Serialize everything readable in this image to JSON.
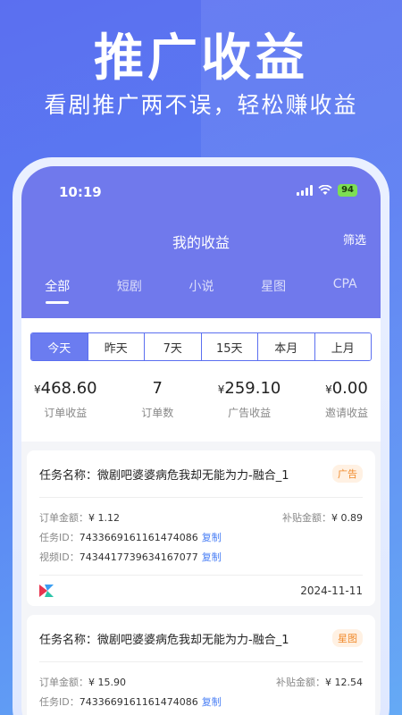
{
  "promo": {
    "title": "推广收益",
    "subtitle": "看剧推广两不误，轻松赚收益"
  },
  "status_bar": {
    "time": "10:19",
    "battery": "94"
  },
  "nav": {
    "title": "我的收益",
    "filter": "筛选"
  },
  "tabs": [
    "全部",
    "短剧",
    "小说",
    "星图",
    "CPA"
  ],
  "periods": [
    "今天",
    "昨天",
    "7天",
    "15天",
    "本月",
    "上月"
  ],
  "stats": [
    {
      "currency": "¥",
      "value": "468.60",
      "label": "订单收益"
    },
    {
      "currency": "",
      "value": "7",
      "label": "订单数"
    },
    {
      "currency": "¥",
      "value": "259.10",
      "label": "广告收益"
    },
    {
      "currency": "¥",
      "value": "0.00",
      "label": "邀请收益"
    }
  ],
  "labels": {
    "task": "任务名称：",
    "order_amount": "订单金额：",
    "subsidy": "补贴金额：",
    "task_id": "任务ID：",
    "video_id": "视频ID：",
    "copy": "复制"
  },
  "cards": [
    {
      "task_name": "微剧吧婆婆病危我却无能为力-融合_1",
      "badge": "广告",
      "order_amount": "¥ 1.12",
      "subsidy": "¥ 0.89",
      "task_id": "7433669161161474086",
      "video_id": "7434417739634167077",
      "date": "2024-11-11"
    },
    {
      "task_name": "微剧吧婆婆病危我却无能为力-融合_1",
      "badge": "星图",
      "order_amount": "¥ 15.90",
      "subsidy": "¥ 12.54",
      "task_id": "7433669161161474086"
    }
  ],
  "colors": {
    "accent": "#7079ec",
    "link": "#4a7ff5",
    "badge": "#f08a2b"
  }
}
